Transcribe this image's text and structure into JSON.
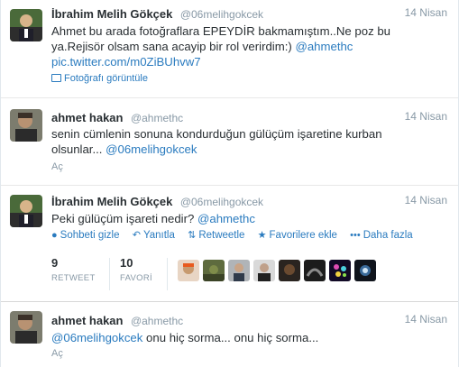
{
  "tweets": [
    {
      "fullname": "İbrahim Melih Gökçek",
      "username": "@06melihgokcek",
      "time": "14 Nisan",
      "text_line1": "Ahmet bu arada fotoğraflara EPEYDİR bakmamıştım..Ne poz bu",
      "text_line2_plain": "ya.Rejisör olsam sana acayip bir rol verirdim:) ",
      "text_line2_link": "@ahmethc",
      "text_line3_link": "pic.twitter.com/m0ZiBUhvw7",
      "media_label": "Fotoğrafı görüntüle"
    },
    {
      "fullname": "ahmet hakan",
      "username": "@ahmethc",
      "time": "14 Nisan",
      "text_line1": "senin cümlenin sonuna kondurduğun gülüçüm işaretine kurban",
      "text_line2_plain": "olsunlar... ",
      "text_line2_link": "@06melihgokcek",
      "expand_label": "Aç"
    },
    {
      "fullname": "İbrahim Melih Gökçek",
      "username": "@06melihgokcek",
      "time": "14 Nisan",
      "text_plain": "Peki gülüçüm işareti nedir? ",
      "text_link": "@ahmethc",
      "actions": {
        "hide": "Sohbeti gizle",
        "reply": "Yanıtla",
        "retweet": "Retweetle",
        "favorite": "Favorilere ekle",
        "more": "Daha fazla"
      },
      "stats": {
        "retweets_count": "9",
        "retweets_label": "RETWEET",
        "favorites_count": "10",
        "favorites_label": "FAVORİ"
      }
    },
    {
      "fullname": "ahmet hakan",
      "username": "@ahmethc",
      "time": "14 Nisan",
      "text_link": "@06melihgokcek",
      "text_plain": " onu hiç sorma... onu hiç sorma...",
      "expand_label": "Aç"
    }
  ],
  "icons": {
    "hide": "conversation-icon",
    "reply": "reply-icon",
    "retweet": "retweet-icon",
    "favorite": "star-icon",
    "more": "more-dots-icon",
    "media": "photo-icon"
  },
  "colors": {
    "link": "#2a7bbf",
    "meta": "#8899a6",
    "text": "#292f33"
  }
}
